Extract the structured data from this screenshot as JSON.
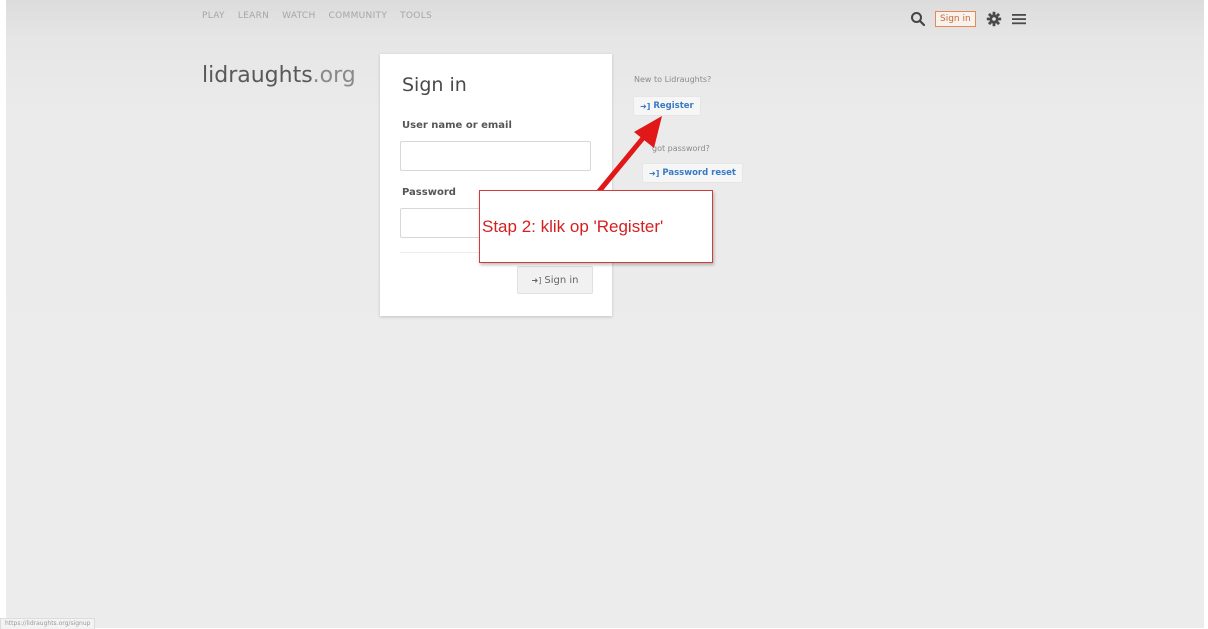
{
  "nav": {
    "items": [
      "PLAY",
      "LEARN",
      "WATCH",
      "COMMUNITY",
      "TOOLS"
    ],
    "signin_label": "Sign in"
  },
  "logo": {
    "name": "lidraughts",
    "tld": ".org"
  },
  "form": {
    "title": "Sign in",
    "username_label": "User name or email",
    "username_value": "",
    "password_label": "Password",
    "password_value": "",
    "submit_label": "Sign in"
  },
  "side": {
    "new_text": "New to Lidraughts?",
    "register_label": "Register",
    "forgot_text": "got password?",
    "reset_label": "Password reset"
  },
  "annotation": {
    "text": "Stap 2: klik op 'Register'",
    "color": "#d42020"
  },
  "status_bar": {
    "url": "https://lidraughts.org/signup"
  },
  "colors": {
    "accent_link": "#3a7ac4",
    "signin_border": "#e08a5a"
  }
}
